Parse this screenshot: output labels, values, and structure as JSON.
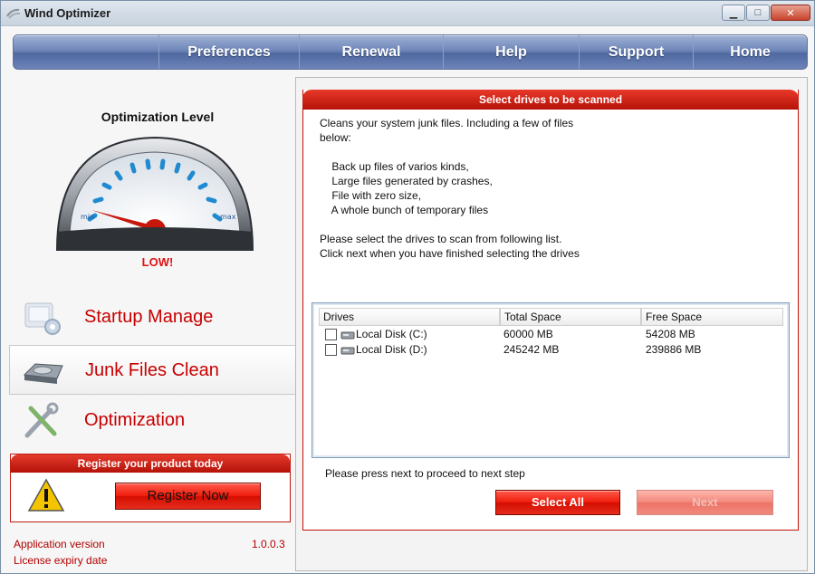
{
  "window": {
    "title": "Wind Optimizer",
    "controls": {
      "minimize": "▁",
      "maximize": "□",
      "close": "✕"
    }
  },
  "nav": {
    "items": [
      "Preferences",
      "Renewal",
      "Help",
      "Support",
      "Home"
    ]
  },
  "gauge": {
    "title": "Optimization Level",
    "min_label": "min",
    "max_label": "max",
    "level_text": "LOW!"
  },
  "sidebar": {
    "items": [
      {
        "label": "Startup Manage",
        "icon": "gear-icon",
        "active": false
      },
      {
        "label": "Junk Files Clean",
        "icon": "hard-drive-icon",
        "active": true
      },
      {
        "label": "Optimization",
        "icon": "tools-icon",
        "active": false
      }
    ]
  },
  "register": {
    "heading": "Register your product today",
    "button_label": "Register Now"
  },
  "footer": {
    "version_label": "Application version",
    "version_value": "1.0.0.3",
    "expiry_label": "License expiry date"
  },
  "scan_panel": {
    "heading": "Select drives to be scanned",
    "intro": "Cleans your system junk files. Including a few of files\nbelow:",
    "list": "    Back up files of varios kinds,\n    Large files generated by crashes,\n    File with zero size,\n    A whole bunch of temporary files",
    "instructions": "Please select the drives to scan from following list.\nClick next when you have finished selecting the drives",
    "table": {
      "columns": [
        "Drives",
        "Total Space",
        "Free Space"
      ],
      "rows": [
        {
          "drive": "Local Disk (C:)",
          "total": "60000 MB",
          "free": "54208 MB"
        },
        {
          "drive": "Local Disk (D:)",
          "total": "245242 MB",
          "free": "239886 MB"
        }
      ]
    },
    "hint": "Please press next to proceed to next step",
    "select_all_label": "Select All",
    "next_label": "Next"
  },
  "colors": {
    "accent_red": "#d40e00",
    "nav_blue": "#5f77ad",
    "text_red": "#c80000"
  }
}
